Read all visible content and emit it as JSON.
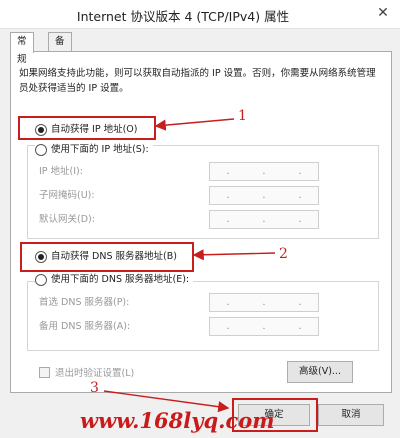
{
  "window": {
    "title": "Internet 协议版本 4 (TCP/IPv4) 属性",
    "close": "✕"
  },
  "tabs": [
    {
      "label": "常规"
    },
    {
      "label": "备用配置"
    }
  ],
  "description": "如果网络支持此功能，则可以获取自动指派的 IP 设置。否则，你需要从网络系统管理员处获得适当的 IP 设置。",
  "ip_section": {
    "auto_label": "自动获得 IP 地址(O)",
    "manual_label": "使用下面的 IP 地址(S):",
    "fields": [
      {
        "label": "IP 地址(I):"
      },
      {
        "label": "子网掩码(U):"
      },
      {
        "label": "默认网关(D):"
      }
    ]
  },
  "dns_section": {
    "auto_label": "自动获得 DNS 服务器地址(B)",
    "manual_label": "使用下面的 DNS 服务器地址(E):",
    "fields": [
      {
        "label": "首选 DNS 服务器(P):"
      },
      {
        "label": "备用 DNS 服务器(A):"
      }
    ]
  },
  "validate_label": "退出时验证设置(L)",
  "buttons": {
    "advanced": "高级(V)...",
    "ok": "确定",
    "cancel": "取消"
  },
  "annotations": {
    "n1": "1",
    "n2": "2",
    "n3": "3"
  },
  "watermark": "www.168lyq.com",
  "colors": {
    "annotation": "#c81e1e"
  }
}
